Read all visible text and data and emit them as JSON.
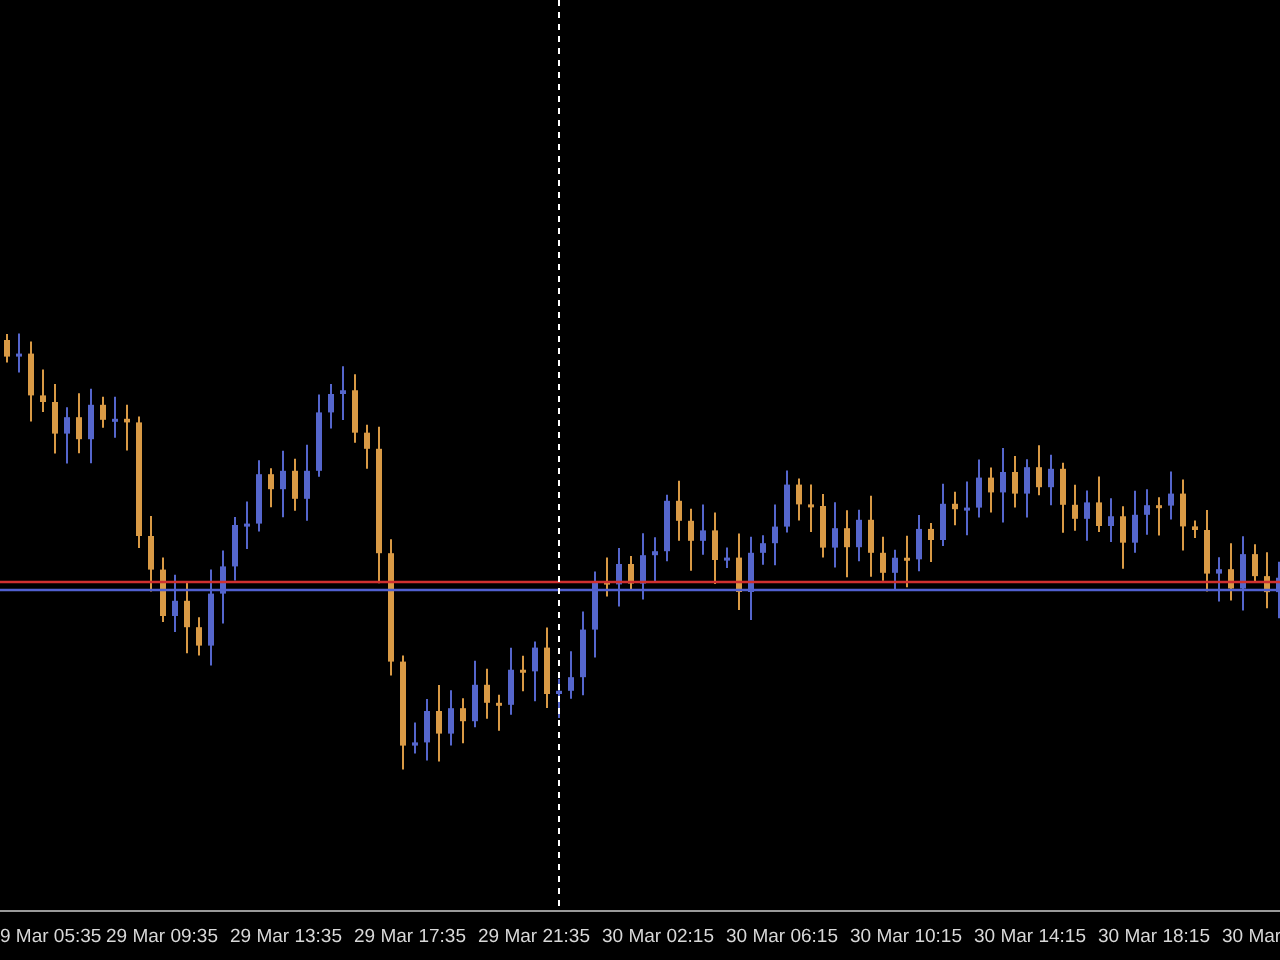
{
  "time_axis": {
    "labels": [
      "9 Mar 05:35",
      "29 Mar 09:35",
      "29 Mar 13:35",
      "29 Mar 17:35",
      "29 Mar 21:35",
      "30 Mar 02:15",
      "30 Mar 06:15",
      "30 Mar 10:15",
      "30 Mar 14:15",
      "30 Mar 18:15",
      "30 Mar"
    ]
  }
}
